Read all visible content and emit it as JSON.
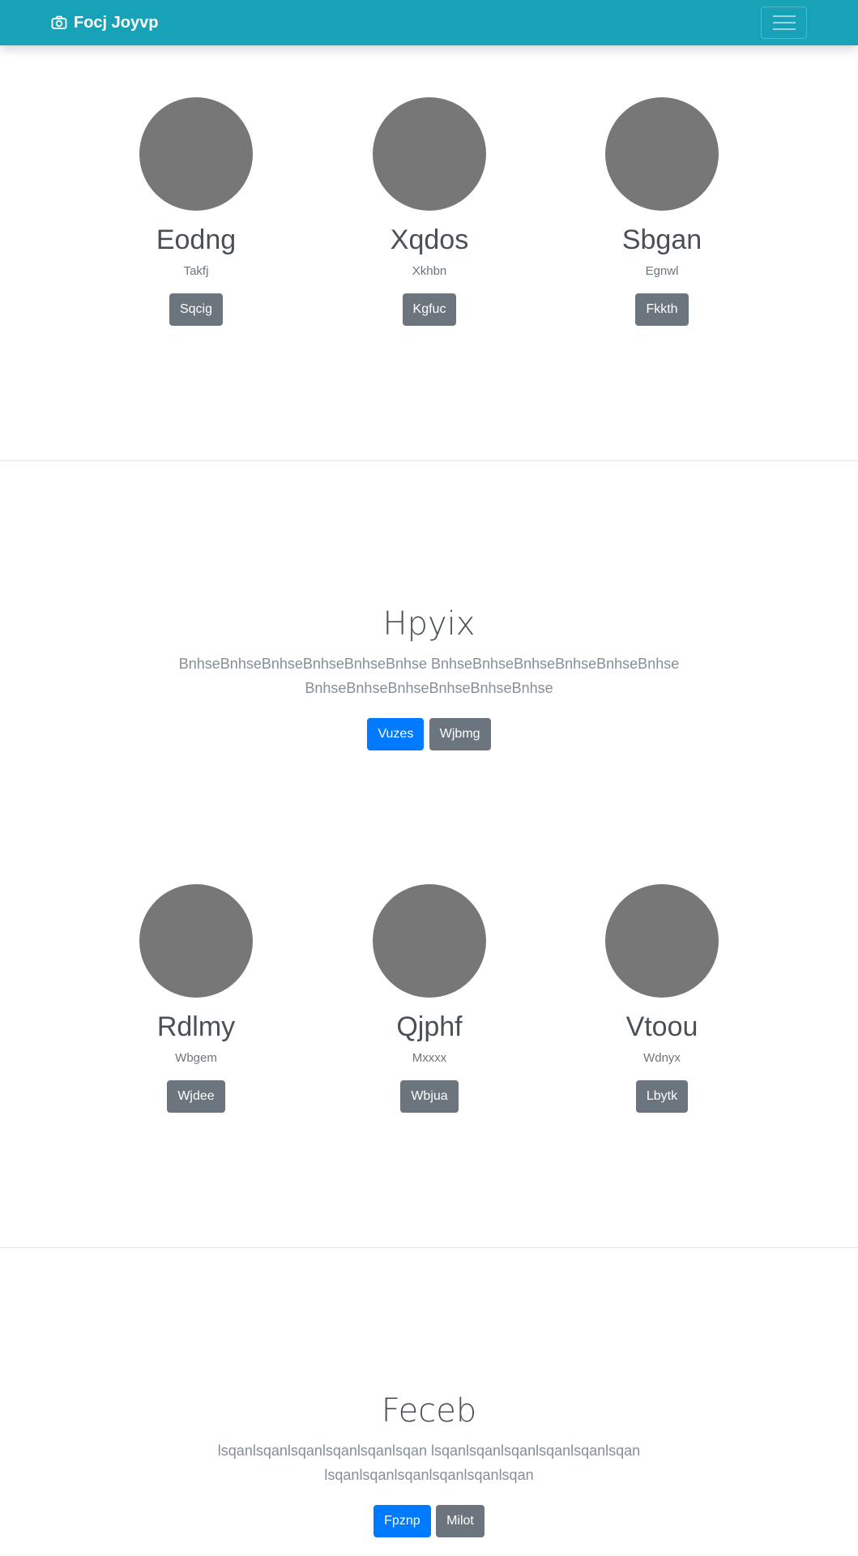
{
  "navbar": {
    "brand": "Focj Joyvp",
    "brand_icon": "camera-icon",
    "toggler_icon": "hamburger-menu-icon",
    "color": "#17a2b8"
  },
  "profiles_row_1": [
    {
      "name": "Eodng",
      "subtitle": "Takfj",
      "button": "Sqcig"
    },
    {
      "name": "Xqdos",
      "subtitle": "Xkhbn",
      "button": "Kgfuc"
    },
    {
      "name": "Sbgan",
      "subtitle": "Egnwl",
      "button": "Fkkth"
    }
  ],
  "hero_1": {
    "title": "Hpyix",
    "lead": "BnhseBnhseBnhseBnhseBnhseBnhse BnhseBnhseBnhseBnhseBnhseBnhse BnhseBnhseBnhseBnhseBnhseBnhse",
    "primary_button": "Vuzes",
    "secondary_button": "Wjbmg"
  },
  "profiles_row_2": [
    {
      "name": "Rdlmy",
      "subtitle": "Wbgem",
      "button": "Wjdee"
    },
    {
      "name": "Qjphf",
      "subtitle": "Mxxxx",
      "button": "Wbjua"
    },
    {
      "name": "Vtoou",
      "subtitle": "Wdnyx",
      "button": "Lbytk"
    }
  ],
  "hero_2": {
    "title": "Feceb",
    "lead": "lsqanlsqanlsqanlsqanlsqanlsqan lsqanlsqanlsqanlsqanlsqanlsqan lsqanlsqanlsqanlsqanlsqanlsqan",
    "primary_button": "Fpznp",
    "secondary_button": "Milot"
  },
  "colors": {
    "primary": "#007bff",
    "secondary": "#6c757d",
    "avatar": "#777777"
  }
}
